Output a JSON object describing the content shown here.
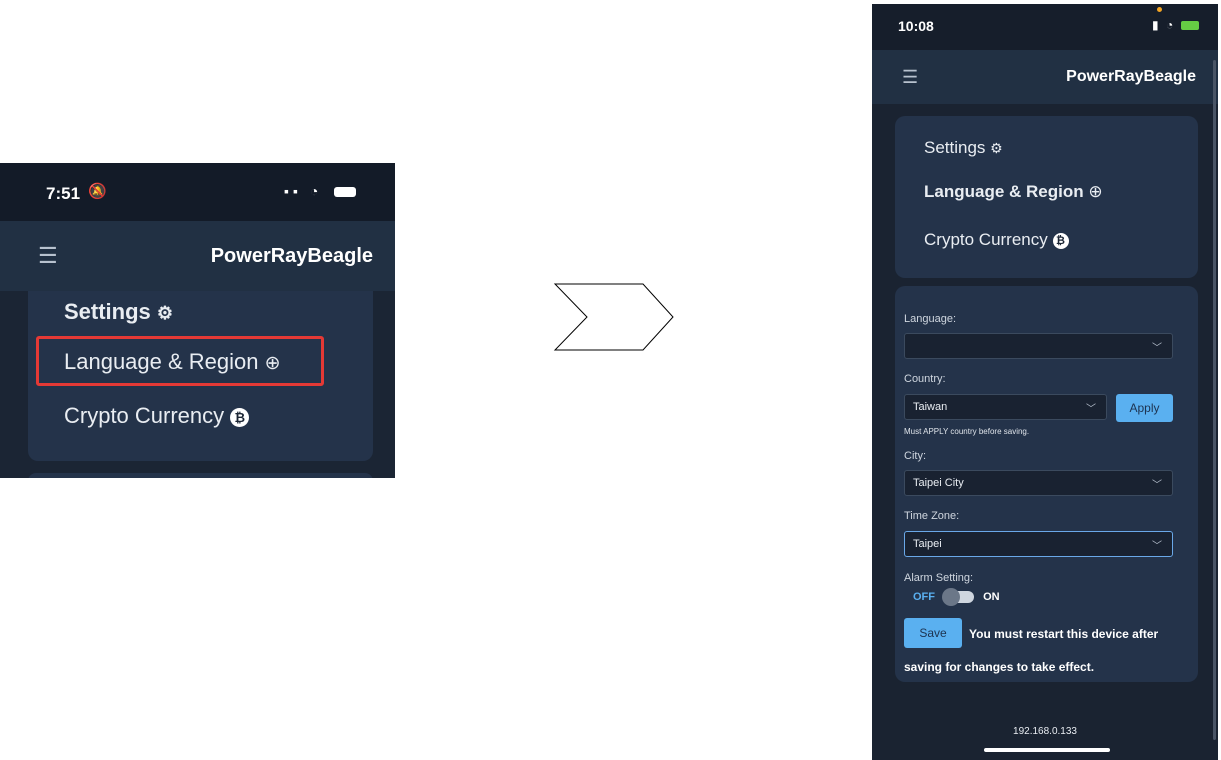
{
  "left": {
    "status_time": "7:51",
    "app_title": "PowerRayBeagle",
    "menu": {
      "settings": "Settings",
      "language_region": "Language & Region",
      "crypto": "Crypto Currency"
    }
  },
  "right": {
    "status_time": "10:08",
    "app_title": "PowerRayBeagle",
    "nav": {
      "settings": "Settings",
      "language_region": "Language & Region",
      "crypto": "Crypto Currency"
    },
    "form": {
      "language_label": "Language:",
      "language_value": "",
      "country_label": "Country:",
      "country_value": "Taiwan",
      "apply_label": "Apply",
      "country_hint": "Must APPLY country before saving.",
      "city_label": "City:",
      "city_value": "Taipei City",
      "timezone_label": "Time Zone:",
      "timezone_value": "Taipei",
      "alarm_label": "Alarm Setting:",
      "alarm_off": "OFF",
      "alarm_on": "ON",
      "save_label": "Save",
      "notice_line1": "You must restart this device after",
      "notice_line2": "saving for changes to take effect."
    },
    "footer_ip": "192.168.0.133"
  },
  "colors": {
    "background": "#1a2331",
    "card": "#24334a",
    "accent": "#5ab0f0",
    "highlight": "#e53935"
  }
}
